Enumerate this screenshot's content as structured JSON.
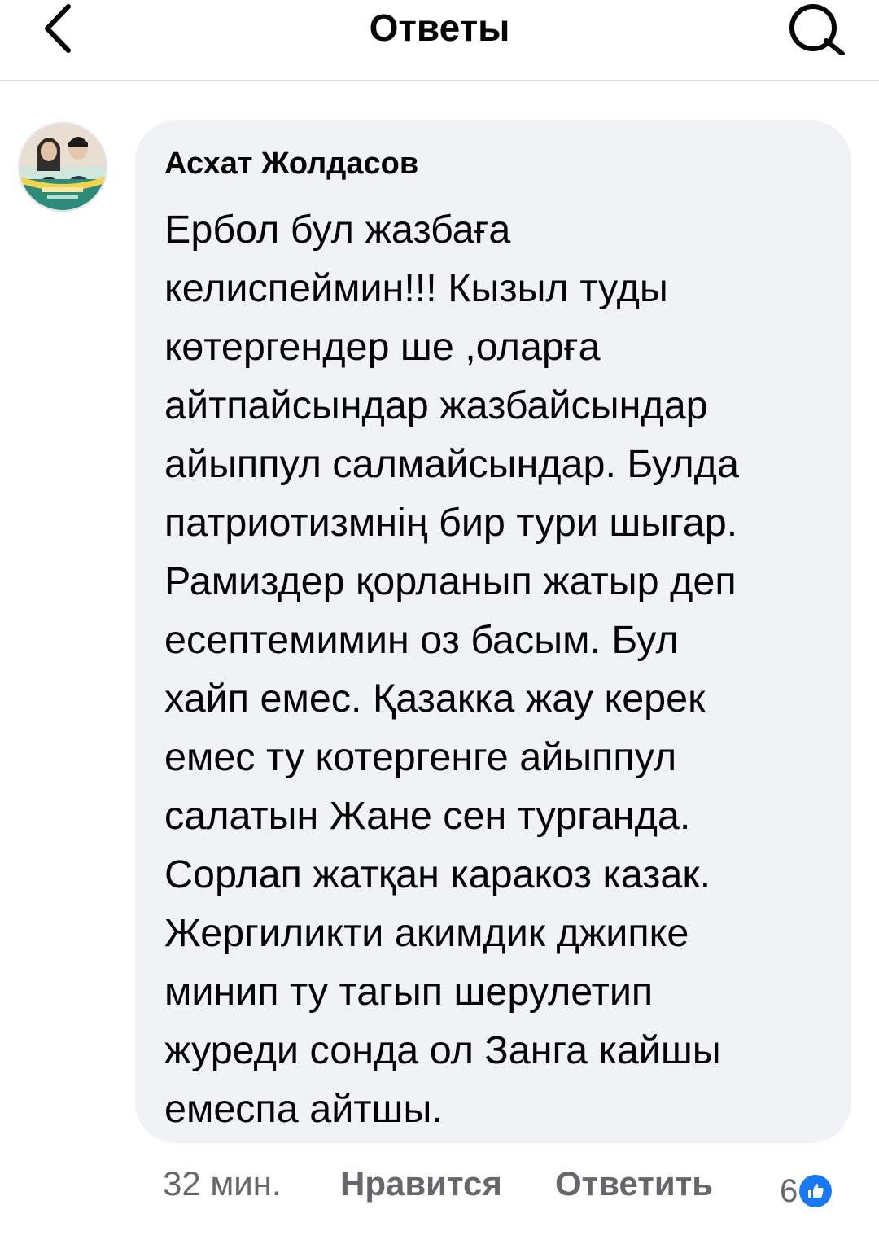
{
  "header": {
    "title": "Ответы",
    "back_icon": "chevron-left-icon",
    "search_icon": "search-icon"
  },
  "comment": {
    "author": "Асхат Жолдасов",
    "avatar_icon": "profile-photo",
    "lines": [
      "Ербол бул жазбаға",
      "келиспеймин!!! Кызыл туды",
      "көтергендер ше ,оларға",
      "айтпайсындар жазбайсындар",
      "айыппул салмайсындар. Булда",
      "патриотизмнің бир тури шыгар.",
      "Рамиздер қорланып жатыр деп",
      "есептемимин оз басым. Бул",
      "хайп емес. Қазакка жау керек",
      "емес ту котергенге айыппул",
      "салатын Жане сен турганда.",
      "Сорлап жатқан каракоз казак.",
      "Жергиликти акимдик джипке",
      "минип ту тагып шерулетип",
      "журеди сонда ол Занга кайшы",
      "емеспа айтшы."
    ]
  },
  "footer": {
    "time": "32 мин.",
    "like_label": "Нравится",
    "reply_label": "Ответить",
    "reaction_count": "6",
    "reaction_icon": "like-reaction-icon"
  },
  "colors": {
    "bubble_bg": "#f0f2f5",
    "secondary_text": "#65676b",
    "like_blue": "#1877f2",
    "divider": "#dddfe2"
  }
}
